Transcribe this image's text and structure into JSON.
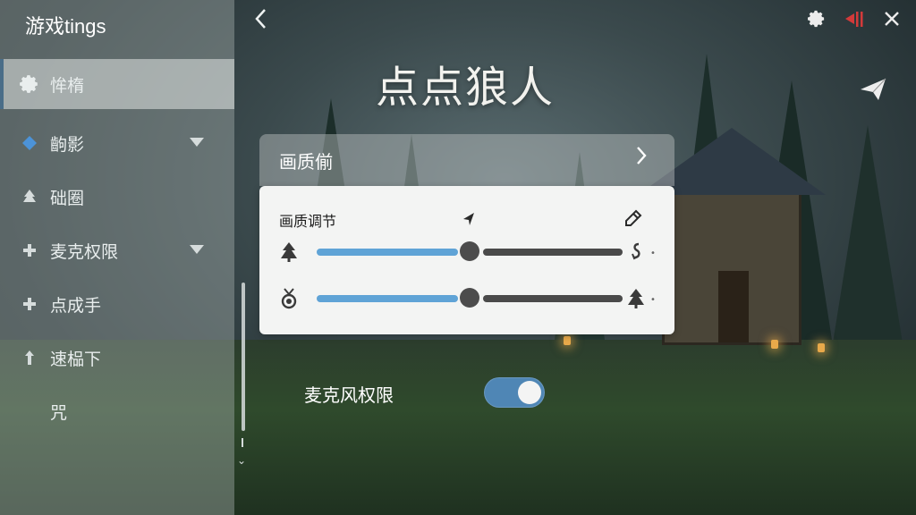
{
  "app": {
    "title": "游戏tings"
  },
  "sidebar": {
    "items": [
      {
        "label": "恈楕",
        "icon": "gear-icon",
        "active": true
      },
      {
        "label": "齣影",
        "icon": "diamond-icon",
        "expandable": true
      },
      {
        "label": "础圈",
        "icon": "tree-icon"
      },
      {
        "label": "麦克权限",
        "icon": "plus-icon",
        "expandable": true
      },
      {
        "label": "点成手",
        "icon": "plus-icon"
      },
      {
        "label": "速榀下",
        "icon": "arrow-up-icon"
      },
      {
        "label": "咒",
        "icon": ""
      }
    ]
  },
  "header": {
    "page_title": "点点狼人",
    "icons": [
      "back-icon",
      "gear-icon",
      "flag-icon",
      "close-icon",
      "share-icon"
    ]
  },
  "settings": {
    "quality_row_label": "画质偂",
    "card_title": "画质调节",
    "sliders": [
      {
        "lead_icon": "tree-icon",
        "value": 0.5,
        "trail_icon": "hook-icon"
      },
      {
        "lead_icon": "medal-icon",
        "value": 0.5,
        "trail_icon": "tree-icon"
      }
    ],
    "mic_toggle": {
      "label": "麦克风权限",
      "on": true
    }
  },
  "colors": {
    "accent": "#5fa3d6",
    "toggle_on": "#4f86b5",
    "flag_red": "#d33a3a"
  }
}
